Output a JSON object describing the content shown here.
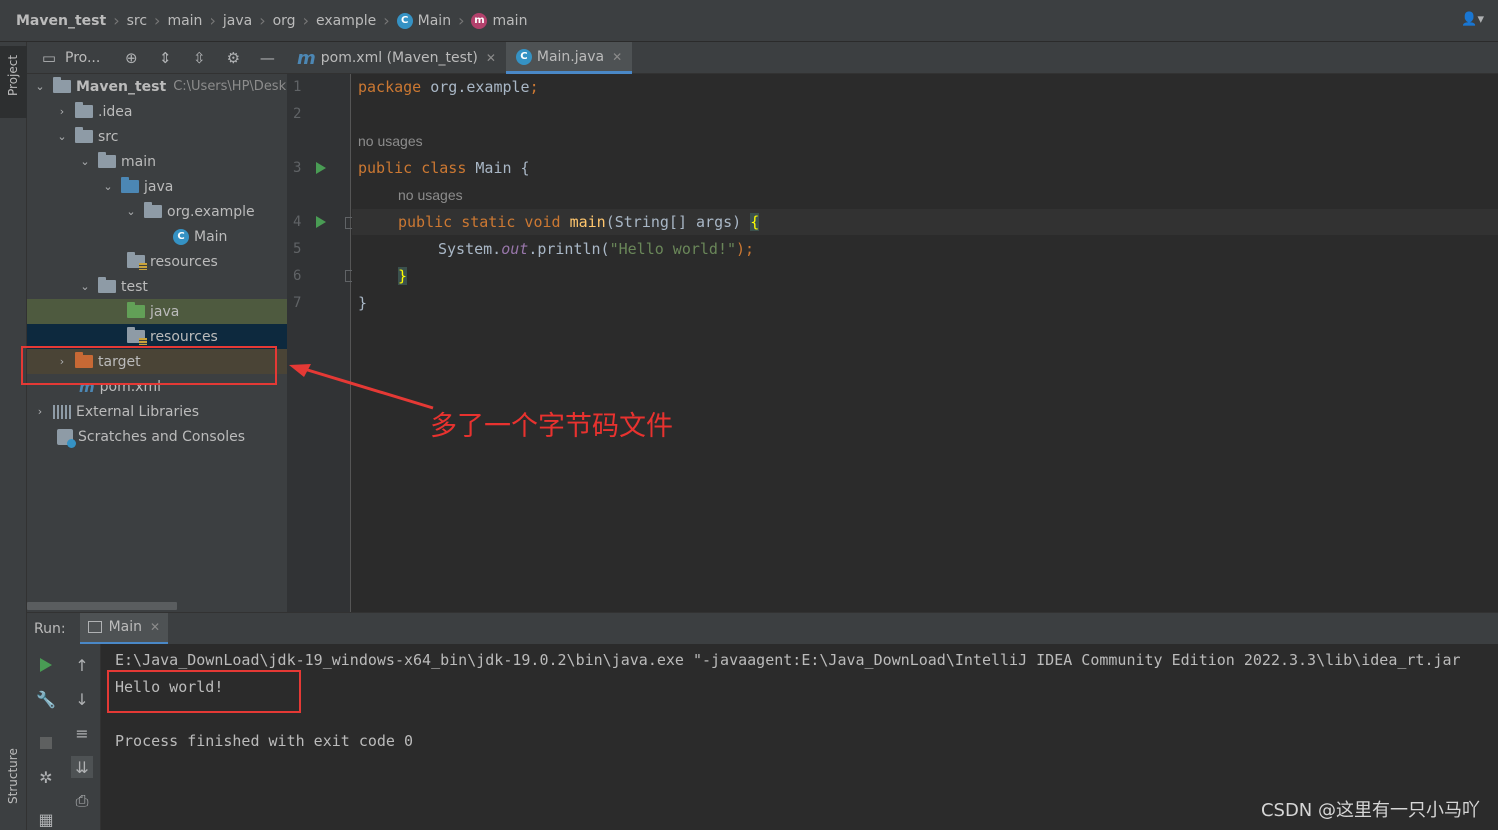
{
  "breadcrumb": {
    "items": [
      "Maven_test",
      "src",
      "main",
      "java",
      "org",
      "example",
      "Main",
      "main"
    ]
  },
  "left_strip": {
    "project_tab": "Project",
    "structure_tab": "Structure"
  },
  "project_panel": {
    "title": "Pro...",
    "tree": {
      "root": "Maven_test",
      "root_path": "C:\\Users\\HP\\Desk",
      "idea": ".idea",
      "src": "src",
      "main": "main",
      "java": "java",
      "package": "org.example",
      "main_class": "Main",
      "resources": "resources",
      "test": "test",
      "test_java": "java",
      "test_resources": "resources",
      "target": "target",
      "pom": "pom.xml",
      "external_libraries": "External Libraries",
      "scratches": "Scratches and Consoles"
    }
  },
  "editor": {
    "tabs": [
      {
        "label": "pom.xml (Maven_test)"
      },
      {
        "label": "Main.java"
      }
    ],
    "line_numbers": [
      "1",
      "2",
      "3",
      "4",
      "5",
      "6",
      "7"
    ],
    "hint_usages": "no usages",
    "code": {
      "l1_kw": "package",
      "l1_rest": " org.example",
      "l1_semi": ";",
      "l3_kw": "public class",
      "l3_rest": " Main {",
      "l4_kw": "public static void",
      "l4_fn": " main",
      "l4_rest": "(String[] args) ",
      "l4_brace": "{",
      "l5_a": "System.",
      "l5_out": "out",
      "l5_b": ".println(",
      "l5_str": "\"Hello world!\"",
      "l5_c": ");",
      "l6_brace": "}",
      "l7": "}"
    }
  },
  "run": {
    "label": "Run:",
    "tab": "Main",
    "console": [
      "E:\\Java_DownLoad\\jdk-19_windows-x64_bin\\jdk-19.0.2\\bin\\java.exe \"-javaagent:E:\\Java_DownLoad\\IntelliJ IDEA Community Edition 2022.3.3\\lib\\idea_rt.jar",
      "Hello world!",
      "",
      "Process finished with exit code 0"
    ]
  },
  "annotation": {
    "text": "多了一个字节码文件",
    "color": "#e53935"
  },
  "watermark": "CSDN @这里有一只小马吖"
}
